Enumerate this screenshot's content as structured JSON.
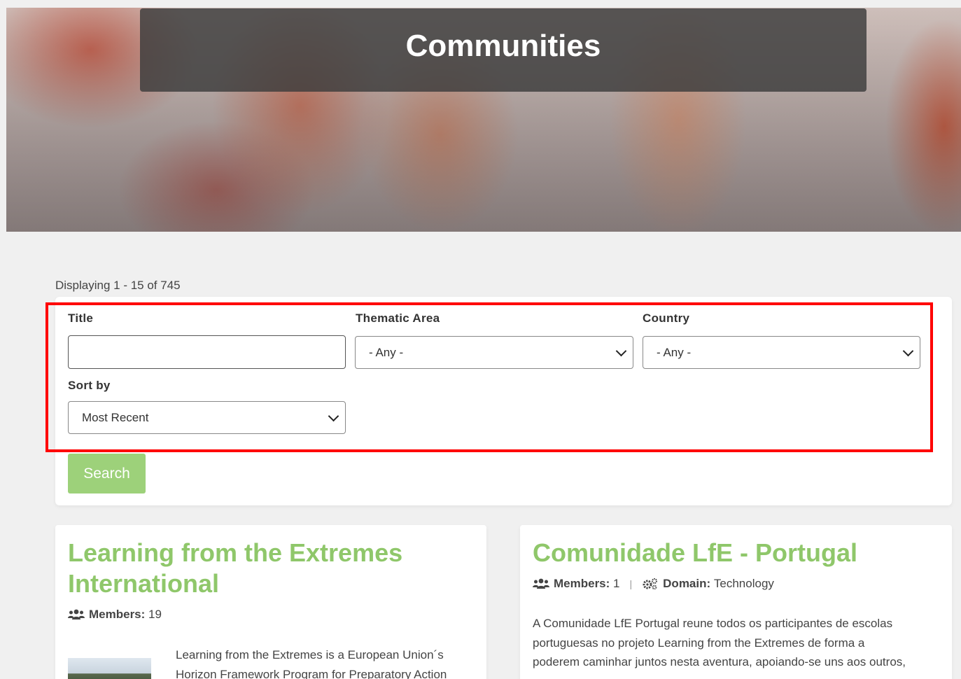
{
  "hero": {
    "title": "Communities"
  },
  "results": {
    "summary": "Displaying 1 - 15 of 745"
  },
  "filters": {
    "title_label": "Title",
    "title_value": "",
    "thematic_label": "Thematic Area",
    "thematic_value": "- Any -",
    "country_label": "Country",
    "country_value": "- Any -",
    "sort_label": "Sort by",
    "sort_value": "Most Recent",
    "search_label": "Search",
    "highlight_color": "#ff0000"
  },
  "cards": [
    {
      "title_line1": "Learning from the Extremes",
      "title_line2": "International",
      "members_label": "Members:",
      "members_count": "19",
      "text_line1": "Learning from the Extremes is a European Union´s",
      "text_line2": "Horizon Framework Program for Preparatory Action"
    },
    {
      "title": "Comunidade LfE - Portugal",
      "members_label": "Members:",
      "members_count": "1",
      "domain_label": "Domain:",
      "domain_value": "Technology",
      "text_line1": "A Comunidade LfE Portugal reune todos os participantes de escolas",
      "text_line2": "portuguesas no projeto Learning from the Extremes de forma a",
      "text_line3": "poderem caminhar juntos nesta aventura, apoiando-se uns aos outros,"
    }
  ],
  "colors": {
    "accent_green": "#8fc76a",
    "button_green": "#9dd17a",
    "page_bg": "#f0f0f0"
  },
  "icons": [
    "users-icon",
    "gears-icon",
    "chevron-down-icon"
  ]
}
